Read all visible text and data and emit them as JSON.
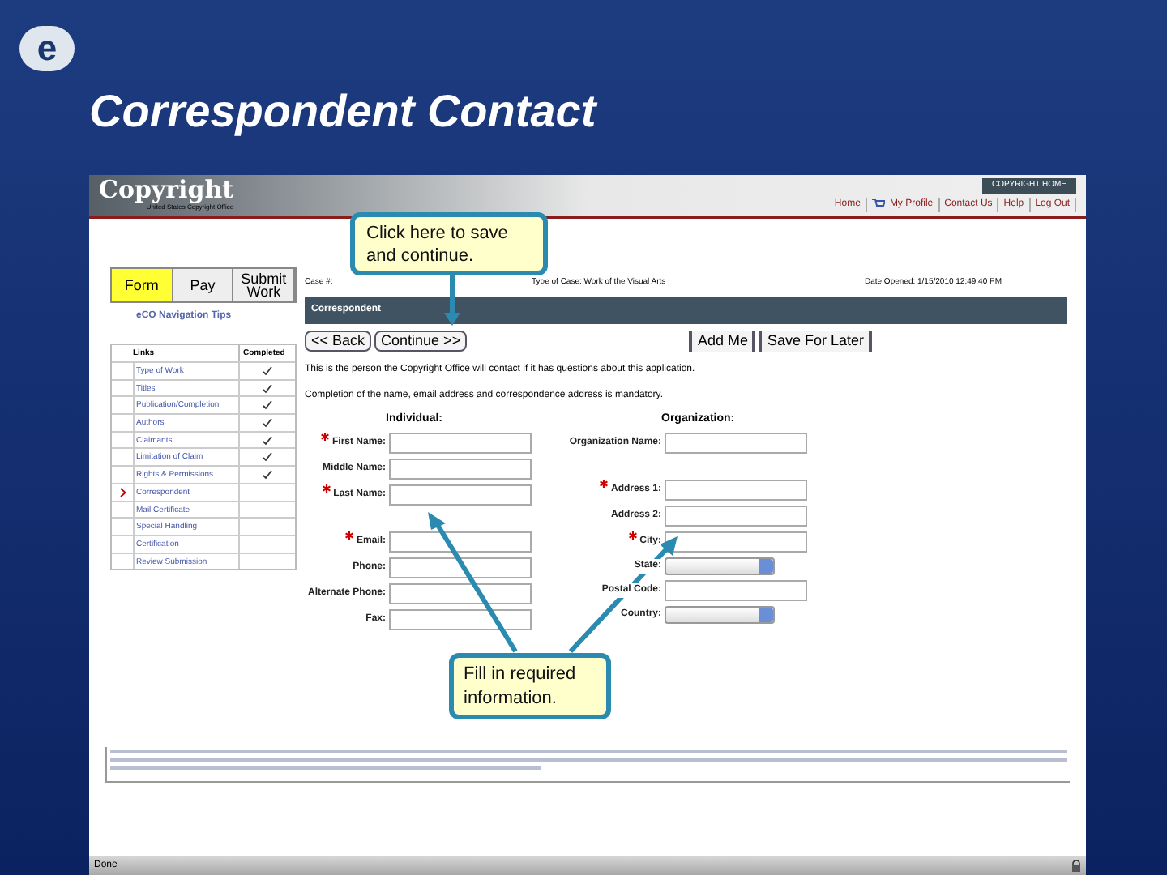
{
  "slide": {
    "logo": "e",
    "title": "Correspondent Contact"
  },
  "site": {
    "brand": "Copyright",
    "subtitle": "United States Copyright Office",
    "home_button": "COPYRIGHT HOME",
    "nav_links": [
      {
        "kind": "text",
        "label": "Home"
      },
      {
        "kind": "cart"
      },
      {
        "kind": "text",
        "label": "My Profile"
      },
      {
        "kind": "text",
        "label": "Contact Us"
      },
      {
        "kind": "text",
        "label": "Help"
      },
      {
        "kind": "text",
        "label": "Log Out"
      }
    ]
  },
  "stage_tabs": [
    {
      "label": "Form",
      "selected": true
    },
    {
      "label": "Pay",
      "selected": false
    },
    {
      "label": "Submit Work",
      "selected": false
    }
  ],
  "nav_tips": "eCO Navigation Tips",
  "links_table": {
    "columns": [
      "Links",
      "Completed"
    ],
    "rows": [
      {
        "label": "Type of Work",
        "completed": true,
        "selected": false
      },
      {
        "label": "Titles",
        "completed": true,
        "selected": false
      },
      {
        "label": "Publication/Completion",
        "completed": true,
        "selected": false
      },
      {
        "label": "Authors",
        "completed": true,
        "selected": false
      },
      {
        "label": "Claimants",
        "completed": true,
        "selected": false
      },
      {
        "label": "Limitation of Claim",
        "completed": true,
        "selected": false
      },
      {
        "label": "Rights & Permissions",
        "completed": true,
        "selected": false
      },
      {
        "label": "Correspondent",
        "completed": false,
        "selected": true
      },
      {
        "label": "Mail Certificate",
        "completed": false,
        "selected": false
      },
      {
        "label": "Special Handling",
        "completed": false,
        "selected": false
      },
      {
        "label": "Certification",
        "completed": false,
        "selected": false
      },
      {
        "label": "Review Submission",
        "completed": false,
        "selected": false
      }
    ]
  },
  "case_info": [
    {
      "label": "Case #:"
    },
    {
      "label": "Type of Case:",
      "value": "Work of the Visual Arts"
    },
    {
      "label": "Date Opened:",
      "value": "1/15/2010 12:49:40 PM"
    }
  ],
  "section_title": "Correspondent",
  "buttons_left": [
    "<< Back",
    "Continue >>"
  ],
  "buttons_right": [
    "Add Me",
    "Save For Later"
  ],
  "intro": [
    "This is the person the Copyright Office will contact if it has questions about this application.",
    "Completion of the name, email address and correspondence address is mandatory."
  ],
  "individual": {
    "heading": "Individual:",
    "groups": [
      [
        {
          "label": "First Name:",
          "required": true,
          "kind": "text"
        },
        {
          "label": "Middle Name:",
          "required": false,
          "kind": "text"
        },
        {
          "label": "Last Name:",
          "required": true,
          "kind": "text"
        }
      ],
      [
        {
          "label": "Email:",
          "required": true,
          "kind": "text"
        },
        {
          "label": "Phone:",
          "required": false,
          "kind": "text"
        },
        {
          "label": "Alternate Phone:",
          "required": false,
          "kind": "text"
        },
        {
          "label": "Fax:",
          "required": false,
          "kind": "text"
        }
      ]
    ]
  },
  "organization": {
    "heading": "Organization:",
    "groups": [
      [
        {
          "label": "Organization Name:",
          "required": false,
          "kind": "text"
        }
      ],
      [
        {
          "label": "Address 1:",
          "required": true,
          "kind": "text"
        },
        {
          "label": "Address 2:",
          "required": false,
          "kind": "text"
        },
        {
          "label": "City:",
          "required": true,
          "kind": "text"
        },
        {
          "label": "State:",
          "required": false,
          "kind": "select"
        },
        {
          "label": "Postal Code:",
          "required": false,
          "kind": "text"
        },
        {
          "label": "Country:",
          "required": false,
          "kind": "select"
        }
      ]
    ]
  },
  "status_bar": {
    "text": "Done"
  },
  "callouts": [
    "Click here to save and continue.",
    "Fill in required information."
  ]
}
